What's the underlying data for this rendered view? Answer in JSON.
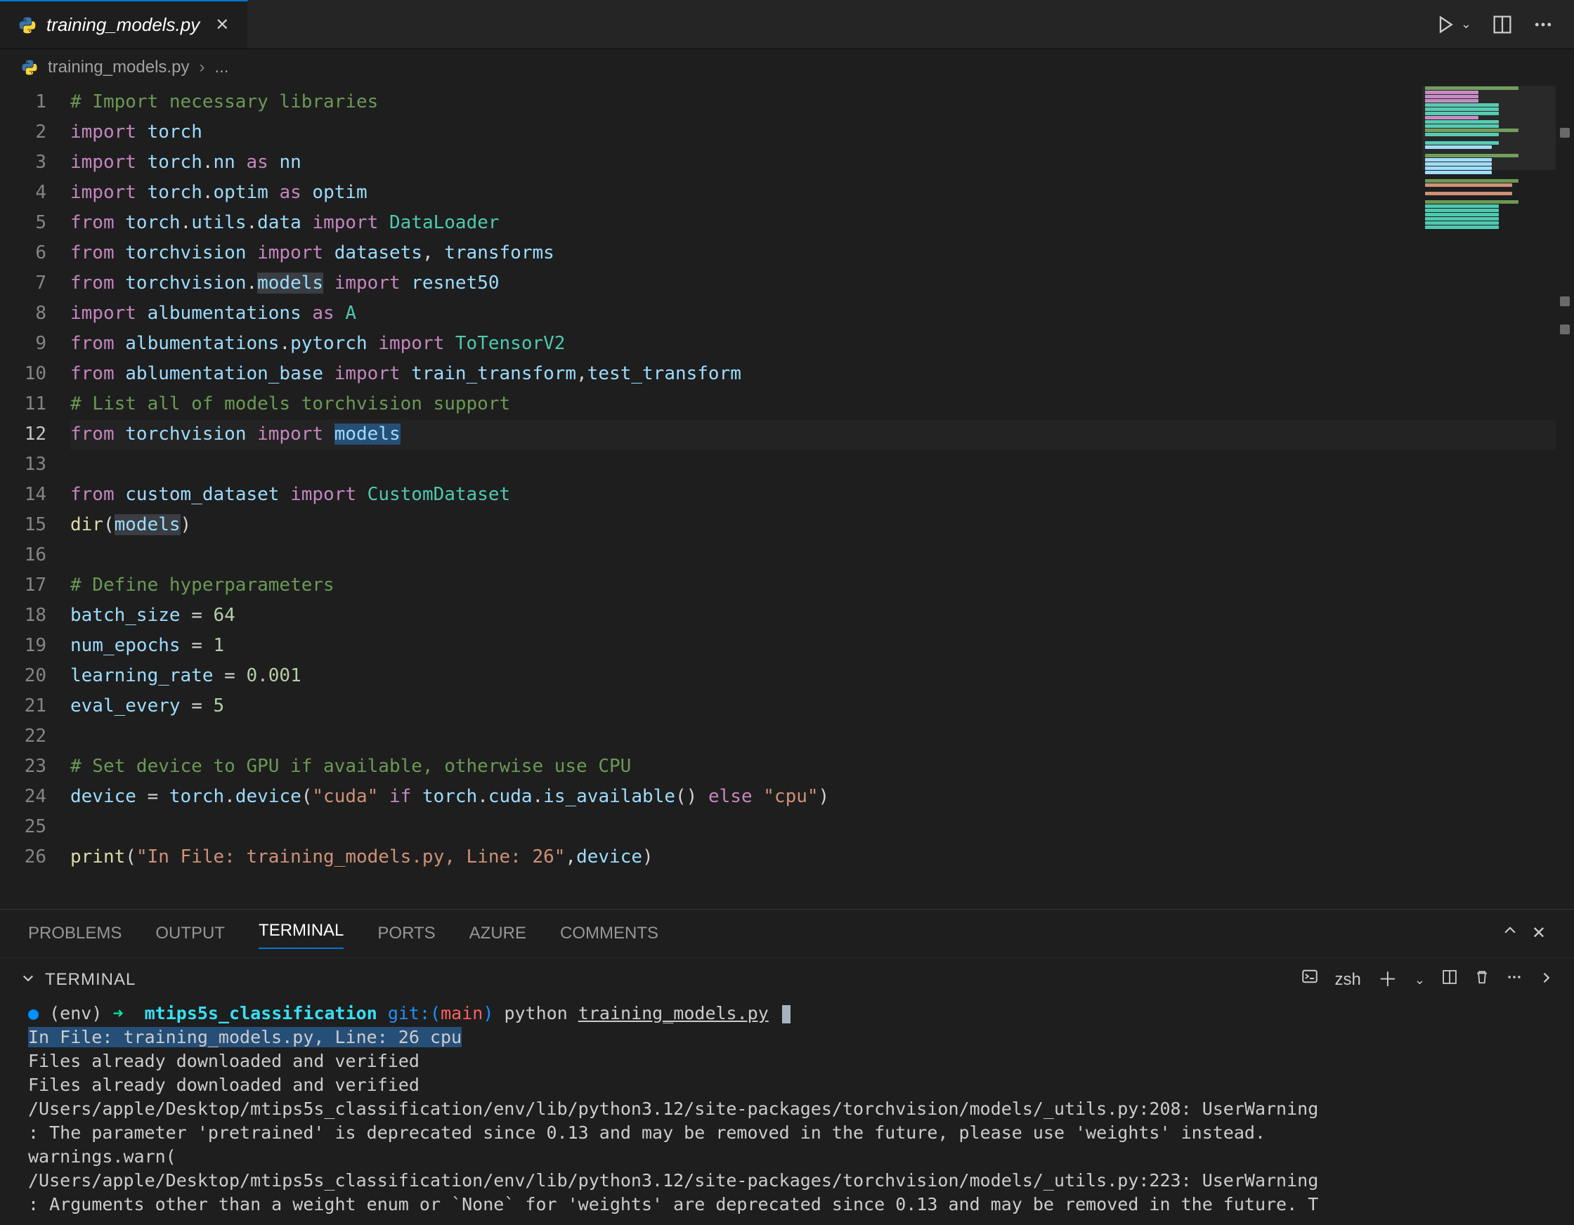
{
  "tab": {
    "filename": "training_models.py"
  },
  "breadcrumb": {
    "file": "training_models.py",
    "rest": "..."
  },
  "code_lines": [
    "# Import necessary libraries",
    "import torch",
    "import torch.nn as nn",
    "import torch.optim as optim",
    "from torch.utils.data import DataLoader",
    "from torchvision import datasets, transforms",
    "from torchvision.models import resnet50",
    "import albumentations as A",
    "from albumentations.pytorch import ToTensorV2",
    "from ablumentation_base import train_transform,test_transform",
    "# List all of models torchvision support",
    "from torchvision import models",
    "",
    "from custom_dataset import CustomDataset",
    "dir(models)",
    "",
    "# Define hyperparameters",
    "batch_size = 64",
    "num_epochs = 1",
    "learning_rate = 0.001",
    "eval_every = 5",
    "",
    "# Set device to GPU if available, otherwise use CPU",
    "device = torch.device(\"cuda\" if torch.cuda.is_available() else \"cpu\")",
    "",
    "print(\"In File: training_models.py, Line: 26\",device)"
  ],
  "current_line": 12,
  "visible_line_start": 1,
  "visible_line_end": 26,
  "highlighted_word": "models",
  "panel": {
    "tabs": [
      "PROBLEMS",
      "OUTPUT",
      "TERMINAL",
      "PORTS",
      "AZURE",
      "COMMENTS"
    ],
    "active_tab": "TERMINAL",
    "section_label": "TERMINAL",
    "shell": "zsh"
  },
  "terminal": {
    "env": "(env)",
    "arrow": "➜",
    "cwd": "mtips5s_classification",
    "git_label": "git:",
    "branch": "main",
    "cmd_prefix": "python",
    "cmd_arg": "training_models.py",
    "line2": "In File: training_models.py, Line: 26 cpu",
    "line3": "Files already downloaded and verified",
    "line4": "Files already downloaded and verified",
    "warn1a": "/Users/apple/Desktop/mtips5s_classification/env/lib/python3.12/site-packages/torchvision/models/_utils.py:208: UserWarning",
    "warn1b": ": The parameter 'pretrained' is deprecated since 0.13 and may be removed in the future, please use 'weights' instead.",
    "warn1c": "  warnings.warn(",
    "warn2a": "/Users/apple/Desktop/mtips5s_classification/env/lib/python3.12/site-packages/torchvision/models/_utils.py:223: UserWarning",
    "warn2b": ": Arguments other than a weight enum or `None` for 'weights' are deprecated since 0.13 and may be removed in the future. T"
  }
}
